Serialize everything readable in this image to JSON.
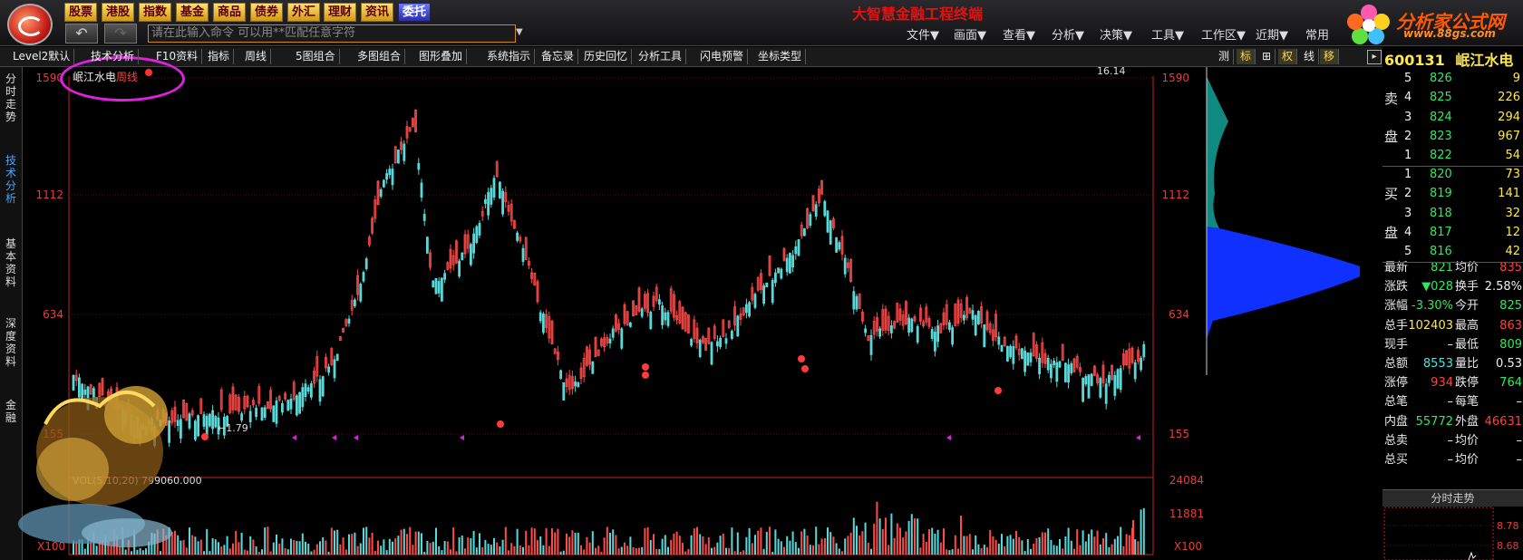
{
  "top_nav": {
    "buttons": [
      "股票",
      "港股",
      "指数",
      "基金",
      "商品",
      "债券",
      "外汇",
      "理财",
      "资讯",
      "委托"
    ],
    "back_icon": "back-arrow-icon",
    "forward_icon": "forward-arrow-icon",
    "command_placeholder": "请在此输入命令    可以用**匹配任意字符",
    "app_title": "大智慧金融工程终端",
    "menus": [
      "文件▼",
      "画面▼",
      "查看▼",
      "分析▼",
      "决策▼",
      "工具▼",
      "工作区▼",
      "近期▼",
      "常用"
    ]
  },
  "brand": {
    "name": "分析家公式网",
    "url": "www.88gs.com"
  },
  "toolbar": {
    "items": [
      "Level2默认",
      "技术分析",
      "F10资料",
      "指标",
      "周线",
      "5图组合",
      "多图组合",
      "图形叠加",
      "系统指示",
      "备忘录",
      "历史回忆",
      "分析工具",
      "闪电预警",
      "坐标类型"
    ],
    "right_items": [
      "测",
      "标",
      "⊞",
      "权",
      "线",
      "移"
    ]
  },
  "side_tabs": [
    "分时走势",
    "技术分析",
    "基本资料",
    "深度资料",
    "金融"
  ],
  "chart": {
    "stock_label": "岷江水电",
    "period_label": "周线",
    "y_ticks": [
      "1590",
      "1112",
      "634",
      "155"
    ],
    "hi_label": "16.14",
    "lo_label": "1.79",
    "vol_label": "VOL(5,10,20) 799060.000",
    "vol_ticks": [
      "24084",
      "11881"
    ],
    "vol_unit": "X100",
    "colors": {
      "up": "#ff4a4a",
      "down": "#58d8d8",
      "axis": "#d02020",
      "bg": "#000000"
    }
  },
  "quote": {
    "code": "600131",
    "name": "岷江水电",
    "sell_label": [
      "卖",
      "盘"
    ],
    "buy_label": [
      "买",
      "盘"
    ],
    "sells": [
      {
        "lvl": "5",
        "price": "826",
        "vol": "9"
      },
      {
        "lvl": "4",
        "price": "825",
        "vol": "226"
      },
      {
        "lvl": "3",
        "price": "824",
        "vol": "294"
      },
      {
        "lvl": "2",
        "price": "823",
        "vol": "967"
      },
      {
        "lvl": "1",
        "price": "822",
        "vol": "54"
      }
    ],
    "buys": [
      {
        "lvl": "1",
        "price": "820",
        "vol": "73"
      },
      {
        "lvl": "2",
        "price": "819",
        "vol": "141"
      },
      {
        "lvl": "3",
        "price": "818",
        "vol": "32"
      },
      {
        "lvl": "4",
        "price": "817",
        "vol": "12"
      },
      {
        "lvl": "5",
        "price": "816",
        "vol": "42"
      }
    ],
    "stats": [
      {
        "l1": "最新",
        "v1": "821",
        "c1": "grn",
        "l2": "均价",
        "v2": "835",
        "c2": "red"
      },
      {
        "l1": "涨跌",
        "v1": "▼028",
        "c1": "grn",
        "l2": "换手",
        "v2": "2.58%",
        "c2": "wht"
      },
      {
        "l1": "涨幅",
        "v1": "-3.30%",
        "c1": "grn",
        "l2": "今开",
        "v2": "825",
        "c2": "grn"
      },
      {
        "l1": "总手",
        "v1": "102403",
        "c1": "ylw",
        "l2": "最高",
        "v2": "863",
        "c2": "red"
      },
      {
        "l1": "现手",
        "v1": "–",
        "c1": "wht",
        "l2": "最低",
        "v2": "809",
        "c2": "grn"
      },
      {
        "l1": "总额",
        "v1": "8553",
        "c1": "cyan",
        "l2": "量比",
        "v2": "0.53",
        "c2": "wht"
      },
      {
        "l1": "涨停",
        "v1": "934",
        "c1": "red",
        "l2": "跌停",
        "v2": "764",
        "c2": "grn"
      },
      {
        "l1": "总笔",
        "v1": "–",
        "c1": "wht",
        "l2": "每笔",
        "v2": "–",
        "c2": "wht"
      },
      {
        "l1": "内盘",
        "v1": "55772",
        "c1": "grn",
        "l2": "外盘",
        "v2": "46631",
        "c2": "red"
      },
      {
        "l1": "总卖",
        "v1": "–",
        "c1": "wht",
        "l2": "均价",
        "v2": "–",
        "c2": "wht"
      },
      {
        "l1": "总买",
        "v1": "–",
        "c1": "wht",
        "l2": "均价",
        "v2": "–",
        "c2": "wht"
      }
    ],
    "timeshare_tab": "分时走势",
    "mini_ticks": [
      "8.78",
      "8.68"
    ]
  }
}
